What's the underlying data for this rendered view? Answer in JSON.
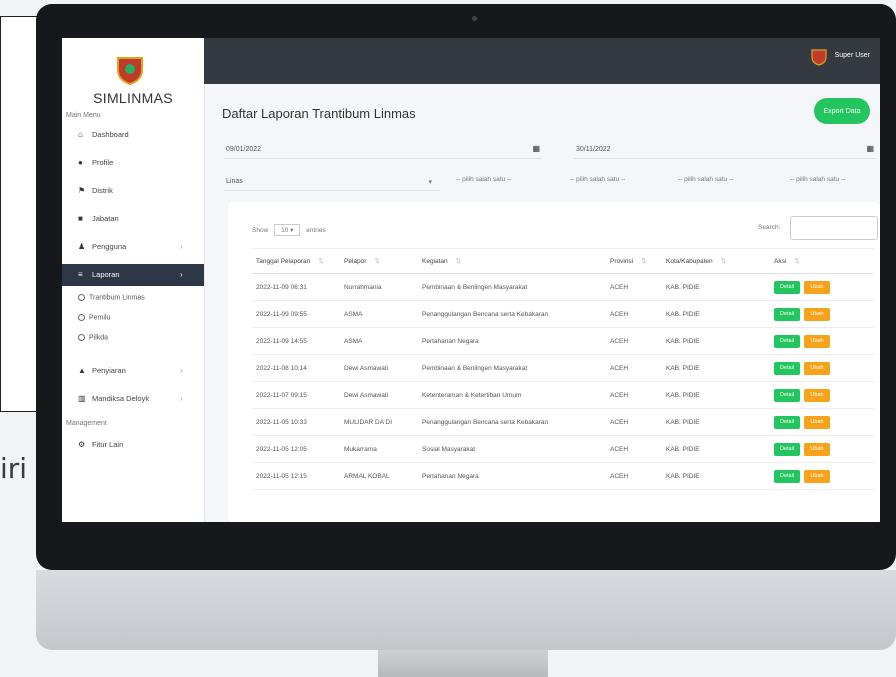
{
  "background": {
    "side_text": "iri"
  },
  "app": {
    "brand": "SIMLINMAS",
    "user_name": "Super User",
    "colors": {
      "topbar": "#343a40",
      "accent_green": "#22c55e",
      "accent_orange": "#f6a21a",
      "active_nav": "#2d3748"
    }
  },
  "sidebar": {
    "main_caption": "Main Menu",
    "items": [
      {
        "label": "Dashboard",
        "icon": "home-icon"
      },
      {
        "label": "Profile",
        "icon": "user-icon"
      },
      {
        "label": "Distrik",
        "icon": "map-icon"
      },
      {
        "label": "Jabatan",
        "icon": "briefcase-icon"
      },
      {
        "label": "Pengguna",
        "icon": "users-icon"
      },
      {
        "label": "Laporan",
        "icon": "report-icon"
      }
    ],
    "subitems": [
      {
        "label": "Trantibum Linmas"
      },
      {
        "label": "Pemilu"
      },
      {
        "label": "Pilkda"
      }
    ],
    "items2": [
      {
        "label": "Penyiaran",
        "icon": "broadcast-icon"
      },
      {
        "label": "Mandiksa Deloyk",
        "icon": "chart-icon"
      }
    ],
    "management_caption": "Management",
    "items3": [
      {
        "label": "Fitur Lain",
        "icon": "gear-icon"
      }
    ]
  },
  "main": {
    "title": "Daftar Laporan Trantibum Linmas",
    "export_label": "Export Data",
    "date_from": "09/01/2022",
    "date_to": "30/11/2022",
    "filter_1": "Linas",
    "filter_2": "-- pilih salah satu --",
    "filter_3": "-- pilih salah satu --",
    "filter_4": "-- pilih salah satu --",
    "filter_5": "-- pilih salah satu --",
    "show_label": "Show",
    "entries_value": "10",
    "entries_label": "entries",
    "search_label": "Search:",
    "columns": [
      "Tanggal Pelaporan",
      "Pelapor",
      "Kegiatan",
      "Provinsi",
      "Kota/Kabupaten",
      "Aksi"
    ],
    "rows": [
      {
        "date": "2022-11-09 06:31",
        "reporter": "Nurrahmania",
        "activity": "Pembinaan & Benlingen Masyarakat",
        "prov": "ACEH",
        "city": "KAB. PIDIE"
      },
      {
        "date": "2022-11-09 09:55",
        "reporter": "ASMA",
        "activity": "Penanggulangan Bencana serta Kebakaran",
        "prov": "ACEH",
        "city": "KAB. PIDIE"
      },
      {
        "date": "2022-11-09 14:55",
        "reporter": "ASMA",
        "activity": "Pertahanan Negara",
        "prov": "ACEH",
        "city": "KAB. PIDIE"
      },
      {
        "date": "2022-11-08 10:14",
        "reporter": "Dewi Asmawati",
        "activity": "Pembinaan & Benlingen Masyarakat",
        "prov": "ACEH",
        "city": "KAB. PIDIE"
      },
      {
        "date": "2022-11-07 09:15",
        "reporter": "Dewi Asmawati",
        "activity": "Ketenteraman & Ketertiban Umum",
        "prov": "ACEH",
        "city": "KAB. PIDIE"
      },
      {
        "date": "2022-11-05 10:33",
        "reporter": "MULIDAR DA DI",
        "activity": "Penanggulangan Bencana serta Kebakaran",
        "prov": "ACEH",
        "city": "KAB. PIDIE"
      },
      {
        "date": "2022-11-05 12:05",
        "reporter": "Mukarrama",
        "activity": "Sosial Masyarakat",
        "prov": "ACEH",
        "city": "KAB. PIDIE"
      },
      {
        "date": "2022-11-05 12:15",
        "reporter": "ARMAL KOBAL",
        "activity": "Pertahanan Negara",
        "prov": "ACEH",
        "city": "KAB. PIDIE"
      }
    ],
    "detail_label": "Detail",
    "ubah_label": "Ubah"
  }
}
